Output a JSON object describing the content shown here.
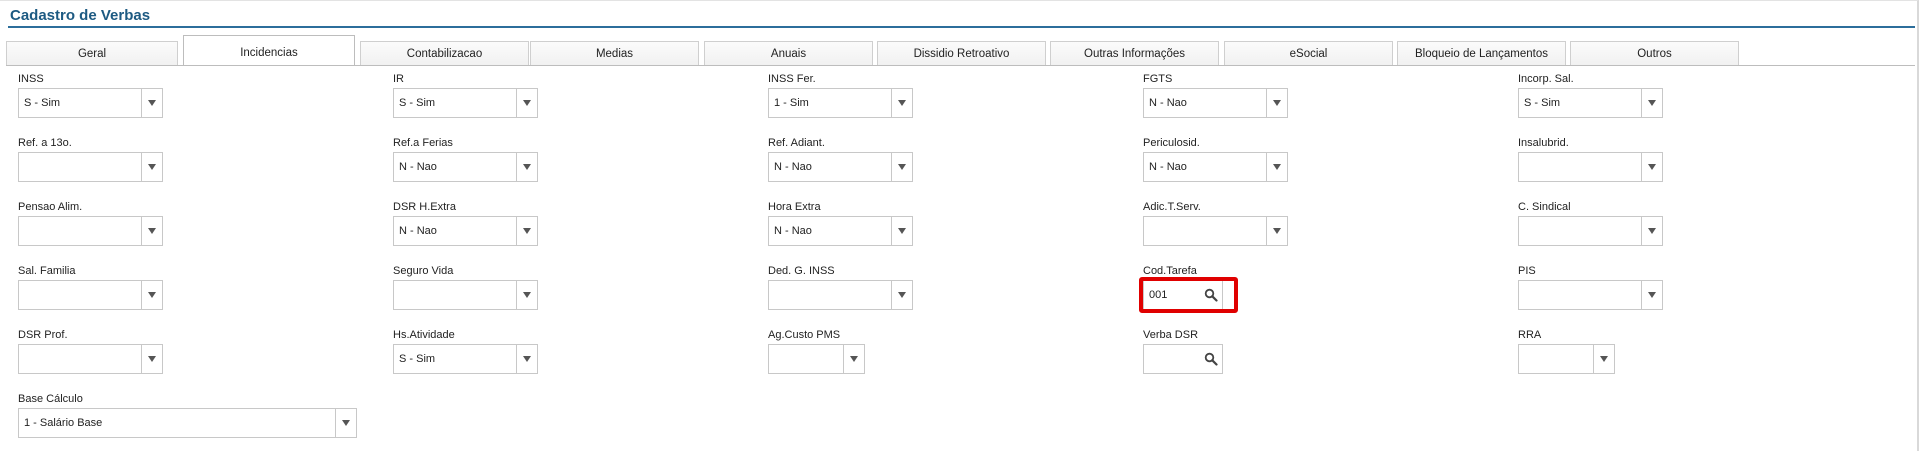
{
  "page_title": "Cadastro de Verbas",
  "tabs": [
    {
      "label": "Geral",
      "active": false
    },
    {
      "label": "Incidencias",
      "active": true
    },
    {
      "label": "Contabilizacao",
      "active": false
    },
    {
      "label": "Medias",
      "active": false
    },
    {
      "label": "Anuais",
      "active": false
    },
    {
      "label": "Dissidio Retroativo",
      "active": false
    },
    {
      "label": "Outras Informações",
      "active": false
    },
    {
      "label": "eSocial",
      "active": false
    },
    {
      "label": "Bloqueio de Lançamentos",
      "active": false
    },
    {
      "label": "Outros",
      "active": false
    }
  ],
  "fields": {
    "inss": {
      "label": "INSS",
      "value": "S - Sim"
    },
    "ir": {
      "label": "IR",
      "value": "S - Sim"
    },
    "inss_fer": {
      "label": "INSS Fer.",
      "value": "1 - Sim"
    },
    "fgts": {
      "label": "FGTS",
      "value": "N - Nao"
    },
    "incorp_sal": {
      "label": "Incorp. Sal.",
      "value": "S - Sim"
    },
    "ref_13o": {
      "label": "Ref. a 13o.",
      "value": ""
    },
    "ref_ferias": {
      "label": "Ref.a Ferias",
      "value": "N - Nao"
    },
    "ref_adiant": {
      "label": "Ref. Adiant.",
      "value": "N - Nao"
    },
    "periculosid": {
      "label": "Periculosid.",
      "value": "N - Nao"
    },
    "insalubrid": {
      "label": "Insalubrid.",
      "value": ""
    },
    "pensao_alim": {
      "label": "Pensao Alim.",
      "value": ""
    },
    "dsr_hextra": {
      "label": "DSR H.Extra",
      "value": "N - Nao"
    },
    "hora_extra": {
      "label": "Hora Extra",
      "value": "N - Nao"
    },
    "adic_tserv": {
      "label": "Adic.T.Serv.",
      "value": ""
    },
    "c_sindical": {
      "label": "C. Sindical",
      "value": ""
    },
    "sal_familia": {
      "label": "Sal. Familia",
      "value": ""
    },
    "seguro_vida": {
      "label": "Seguro Vida",
      "value": ""
    },
    "ded_g_inss": {
      "label": "Ded. G. INSS",
      "value": ""
    },
    "cod_tarefa": {
      "label": "Cod.Tarefa",
      "value": "001"
    },
    "pis": {
      "label": "PIS",
      "value": ""
    },
    "dsr_prof": {
      "label": "DSR Prof.",
      "value": ""
    },
    "hs_atividade": {
      "label": "Hs.Atividade",
      "value": "S - Sim"
    },
    "ag_custo_pms": {
      "label": "Ag.Custo PMS",
      "value": ""
    },
    "verba_dsr": {
      "label": "Verba DSR",
      "value": ""
    },
    "rra": {
      "label": "RRA",
      "value": ""
    },
    "base_calculo": {
      "label": "Base Cálculo",
      "value": "1 - Salário Base"
    }
  },
  "colors": {
    "title": "#1d5a82",
    "highlight": "#e00000"
  }
}
